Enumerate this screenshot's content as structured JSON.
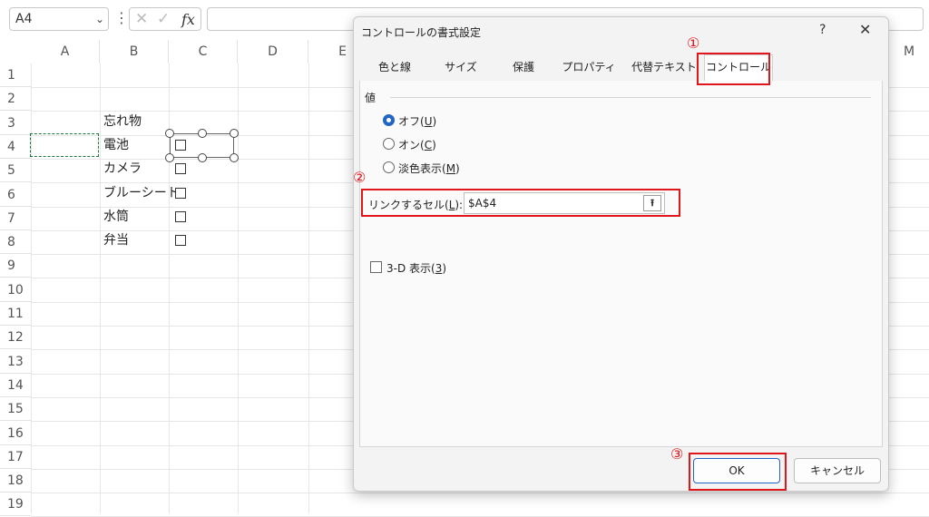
{
  "formula_bar": {
    "name_box": "A4",
    "fx_label": "fx",
    "cancel_glyph": "✕",
    "enter_glyph": "✓"
  },
  "grid": {
    "columns": [
      "A",
      "B",
      "C",
      "D",
      "E",
      "M"
    ],
    "rows": [
      "1",
      "2",
      "3",
      "4",
      "5",
      "6",
      "7",
      "8",
      "9",
      "10",
      "11",
      "12",
      "13",
      "14",
      "15",
      "16",
      "17",
      "18",
      "19"
    ],
    "cells": {
      "B3": "忘れ物",
      "B4": "電池",
      "B5": "カメラ",
      "B6": "ブルーシート",
      "B7": "水筒",
      "B8": "弁当"
    }
  },
  "dialog": {
    "title": "コントロールの書式設定",
    "help": "?",
    "close": "✕",
    "tabs": [
      "色と線",
      "サイズ",
      "保護",
      "プロパティ",
      "代替テキスト",
      "コントロール"
    ],
    "active_tab": "コントロール",
    "value_group": "値",
    "radios": [
      {
        "label": "オフ(",
        "key": "U",
        "selected": true
      },
      {
        "label": "オン(",
        "key": "C",
        "selected": false
      },
      {
        "label": "淡色表示(",
        "key": "M",
        "selected": false
      }
    ],
    "link_cell_label": "リンクするセル(",
    "link_cell_key": "L",
    "link_cell_suffix": "):",
    "link_cell_value": "$A$4",
    "collapse_icon_glyph": "⭱",
    "shading_label": "3-D 表示(",
    "shading_key": "3",
    "ok": "OK",
    "cancel": "キャンセル"
  },
  "annotations": [
    "①",
    "②",
    "③"
  ],
  "colors": {
    "annotation_red": "#e0161b",
    "selection_green": "#217346",
    "accent_blue": "#2365c4"
  }
}
